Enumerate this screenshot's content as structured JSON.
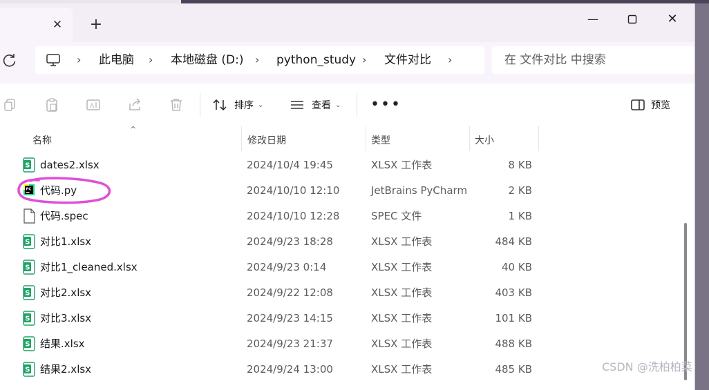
{
  "window": {
    "tab_close_glyph": "✕",
    "new_tab_glyph": "+",
    "minimize_glyph": "—",
    "close_glyph": "✕"
  },
  "address": {
    "breadcrumb": [
      "此电脑",
      "本地磁盘 (D:)",
      "python_study",
      "文件对比"
    ],
    "chevron": "›",
    "search_placeholder": "在 文件对比 中搜索"
  },
  "toolbar": {
    "sort_label": "排序",
    "view_label": "查看",
    "more_label": "•••",
    "preview_label": "预览",
    "caret": "⌄"
  },
  "columns": {
    "name": "名称",
    "date": "修改日期",
    "type": "类型",
    "size": "大小",
    "sort_indicator": "^"
  },
  "files": [
    {
      "name": "dates2.xlsx",
      "date": "2024/10/4 19:45",
      "type": "XLSX 工作表",
      "size": "8 KB",
      "icon": "excel-icon"
    },
    {
      "name": "代码.py",
      "date": "2024/10/10 12:10",
      "type": "JetBrains PyCharm",
      "size": "2 KB",
      "icon": "pycharm-icon"
    },
    {
      "name": "代码.spec",
      "date": "2024/10/10 12:28",
      "type": "SPEC 文件",
      "size": "1 KB",
      "icon": "generic-file-icon"
    },
    {
      "name": "对比1.xlsx",
      "date": "2024/9/23 18:28",
      "type": "XLSX 工作表",
      "size": "484 KB",
      "icon": "excel-icon"
    },
    {
      "name": "对比1_cleaned.xlsx",
      "date": "2024/9/23 0:14",
      "type": "XLSX 工作表",
      "size": "40 KB",
      "icon": "excel-icon"
    },
    {
      "name": "对比2.xlsx",
      "date": "2024/9/22 12:08",
      "type": "XLSX 工作表",
      "size": "403 KB",
      "icon": "excel-icon"
    },
    {
      "name": "对比3.xlsx",
      "date": "2024/9/23 14:15",
      "type": "XLSX 工作表",
      "size": "101 KB",
      "icon": "excel-icon"
    },
    {
      "name": "结果.xlsx",
      "date": "2024/9/23 21:37",
      "type": "XLSX 工作表",
      "size": "488 KB",
      "icon": "excel-icon"
    },
    {
      "name": "结果2.xlsx",
      "date": "2024/9/24 13:00",
      "type": "XLSX 工作表",
      "size": "485 KB",
      "icon": "excel-icon"
    }
  ],
  "watermark": "CSDN @洗柏柏菜",
  "colors": {
    "highlight": "#e04fd6",
    "excel_green": "#21a366",
    "accent": "#0067c0"
  }
}
